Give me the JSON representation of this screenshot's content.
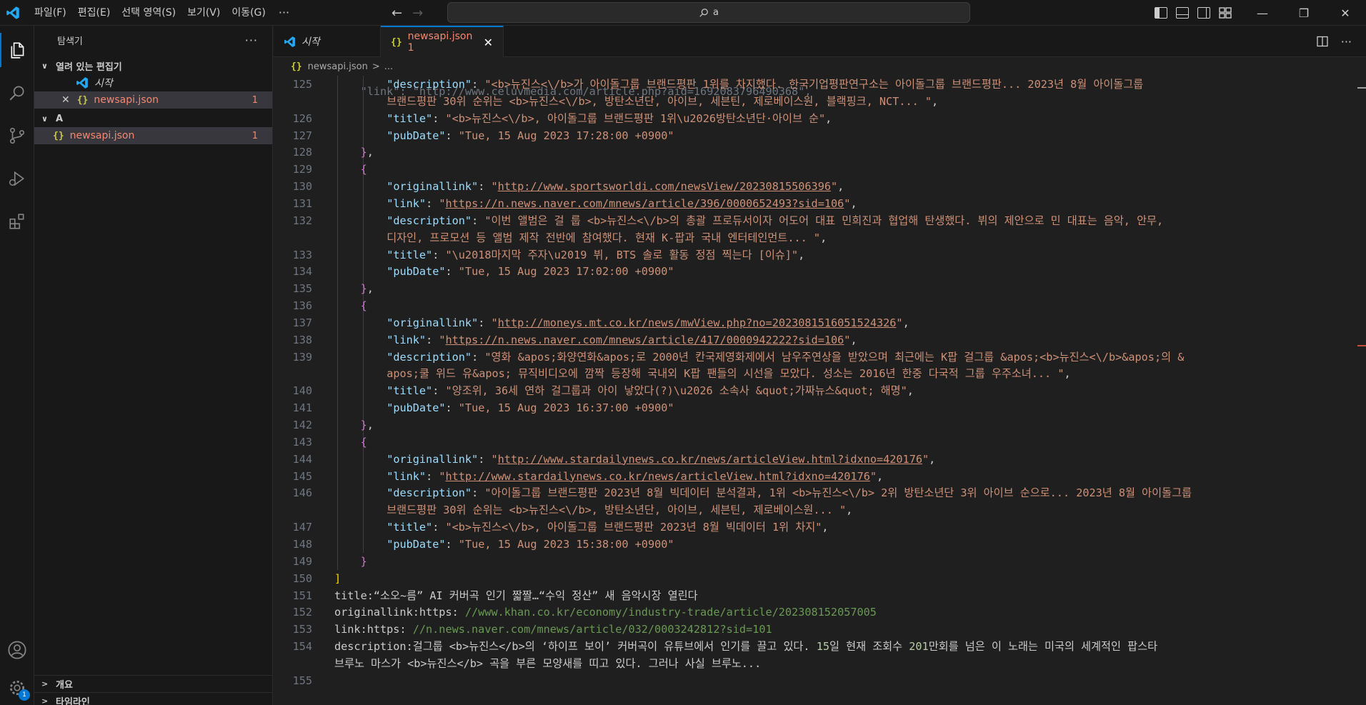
{
  "titlebar": {
    "menu": [
      "파일(F)",
      "편집(E)",
      "선택 영역(S)",
      "보기(V)",
      "이동(G)"
    ],
    "more": "···",
    "search_text": "a"
  },
  "activity": {
    "settings_badge": "1"
  },
  "sidebar": {
    "title": "탐색기",
    "more": "···",
    "open_editors": "열려 있는 편집기",
    "open_items": [
      {
        "label": "시작"
      },
      {
        "label": "newsapi.json",
        "count": "1"
      }
    ],
    "folder": "A",
    "folder_items": [
      {
        "label": "newsapi.json",
        "count": "1"
      }
    ],
    "outline": "개요",
    "timeline": "타임라인"
  },
  "tabs": [
    {
      "label": "시작"
    },
    {
      "label": "newsapi.json 1"
    }
  ],
  "breadcrumb": {
    "file": "newsapi.json",
    "sep": ">",
    "rest": "..."
  },
  "colors": {
    "accent": "#0078d4",
    "error": "#f48771",
    "key": "#9cdcfe",
    "string": "#ce9178"
  },
  "code": {
    "partial_top": "    \"link\": \"http://www.celuvmedia.com/article.php?aid=1692083796490368\",",
    "lines": [
      {
        "n": "125",
        "key": "description",
        "val": "<b>뉴진스<\\/b>가 아이돌그룹 브랜드평판 1위를 차지했다. 한국기업평판연구소는 아이돌그룹 브랜드평판... 2023년 8월 아이돌그룹"
      },
      {
        "n": "",
        "cont": "브랜드평판 30위 순위는 <b>뉴진스<\\/b>, 방탄소년단, 아이브, 세븐틴, 제로베이스원, 블랙핑크, NCT... \","
      },
      {
        "n": "126",
        "key": "title",
        "val": "<b>뉴진스<\\/b>, 아이돌그룹 브랜드평판 1위\\u2026방탄소년단·아이브 순\","
      },
      {
        "n": "127",
        "key": "pubDate",
        "val": "Tue, 15 Aug 2023 17:28:00 +0900\""
      },
      {
        "n": "128",
        "brace": "},",
        "indent": 1
      },
      {
        "n": "129",
        "brace": "{",
        "indent": 1
      },
      {
        "n": "130",
        "key": "originallink",
        "url": "http://www.sportsworldi.com/newsView/20230815506396"
      },
      {
        "n": "131",
        "key": "link",
        "url": "https://n.news.naver.com/mnews/article/396/0000652493?sid=106"
      },
      {
        "n": "132",
        "key": "description",
        "val": "이번 앨범은 걸 룹 <b>뉴진스<\\/b>의 총괄 프로듀서이자 어도어 대표 민희진과 협업해 탄생했다. 뷔의 제안으로 민 대표는 음악, 안무,"
      },
      {
        "n": "",
        "cont": "디자인, 프로모션 등 앨범 제작 전반에 참여했다. 현재 K-팝과 국내 엔터테인먼트... \","
      },
      {
        "n": "133",
        "key": "title",
        "val": "\\u2018마지막 주자\\u2019 뷔, BTS 솔로 활동 정점 찍는다 [이슈]\","
      },
      {
        "n": "134",
        "key": "pubDate",
        "val": "Tue, 15 Aug 2023 17:02:00 +0900\""
      },
      {
        "n": "135",
        "brace": "},",
        "indent": 1
      },
      {
        "n": "136",
        "brace": "{",
        "indent": 1
      },
      {
        "n": "137",
        "key": "originallink",
        "url": "http://moneys.mt.co.kr/news/mwView.php?no=2023081516051524326"
      },
      {
        "n": "138",
        "key": "link",
        "url": "https://n.news.naver.com/mnews/article/417/0000942222?sid=106"
      },
      {
        "n": "139",
        "key": "description",
        "val": "영화 &apos;화양연화&apos;로 2000년 칸국제영화제에서 남우주연상을 받았으며 최근에는 K팝 걸그룹 &apos;<b>뉴진스<\\/b>&apos;의 &"
      },
      {
        "n": "",
        "cont": "apos;쿨 위드 유&apos; 뮤직비디오에 깜짝 등장해 국내외 K팝 팬들의 시선을 모았다. 성소는 2016년 한중 다국적 그룹 우주소녀... \","
      },
      {
        "n": "140",
        "key": "title",
        "val": "양조위, 36세 연하 걸그룹과 아이 낳았다(?)\\u2026 소속사 &quot;가짜뉴스&quot; 해명\","
      },
      {
        "n": "141",
        "key": "pubDate",
        "val": "Tue, 15 Aug 2023 16:37:00 +0900\""
      },
      {
        "n": "142",
        "brace": "},",
        "indent": 1
      },
      {
        "n": "143",
        "brace": "{",
        "indent": 1
      },
      {
        "n": "144",
        "key": "originallink",
        "url": "http://www.stardailynews.co.kr/news/articleView.html?idxno=420176"
      },
      {
        "n": "145",
        "key": "link",
        "url": "http://www.stardailynews.co.kr/news/articleView.html?idxno=420176"
      },
      {
        "n": "146",
        "key": "description",
        "val": "아이돌그룹 브랜드평판 2023년 8월 빅데이터 분석결과, 1위 <b>뉴진스<\\/b> 2위 방탄소년단 3위 아이브 순으로... 2023년 8월 아이돌그룹"
      },
      {
        "n": "",
        "cont": "브랜드평판 30위 순위는 <b>뉴진스<\\/b>, 방탄소년단, 아이브, 세븐틴, 제로베이스원... \","
      },
      {
        "n": "147",
        "key": "title",
        "val": "<b>뉴진스<\\/b>, 아이돌그룹 브랜드평판 2023년 8월 빅데이터 1위 차지\","
      },
      {
        "n": "148",
        "key": "pubDate",
        "val": "Tue, 15 Aug 2023 15:38:00 +0900\""
      },
      {
        "n": "149",
        "brace": "}",
        "indent": 1
      },
      {
        "n": "150",
        "brace": "]",
        "indent": 0
      },
      {
        "n": "151",
        "plain": "title:“소오~름” AI 커버곡 인기 짧짤…“수익 정산” 새 음악시장 열린다"
      },
      {
        "n": "152",
        "plain": "originallink:https:",
        "comment": " //www.khan.co.kr/economy/industry-trade/article/202308152057005"
      },
      {
        "n": "153",
        "plain": "link:https:",
        "comment": " //n.news.naver.com/mnews/article/032/0003242812?sid=101"
      },
      {
        "n": "154",
        "plain": "description:걸그룹 <b>뉴진스</b>의 ‘하이프 보이’ 커버곡이 유튜브에서 인기를 끌고 있다. 15일 현재 조회수 201만회를 넘은 이 노래는 미국의 세계적인 팝스타"
      },
      {
        "n": "",
        "plain": "브루노 마스가 <b>뉴진스</b> 곡을 부른 모양새를 띠고 있다. 그러나 사실 브루노..."
      },
      {
        "n": "155",
        "plain": ""
      }
    ]
  }
}
